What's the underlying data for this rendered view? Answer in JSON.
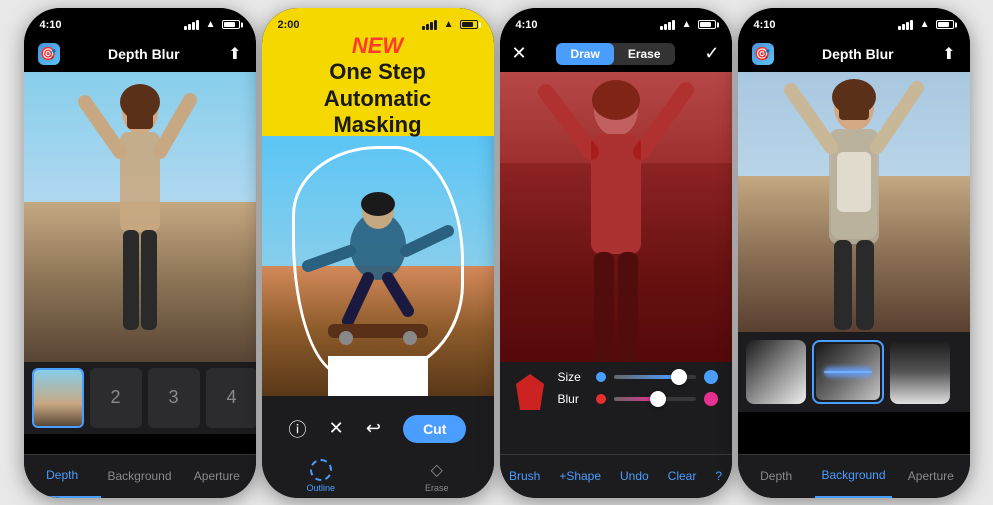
{
  "phones": {
    "phone1": {
      "status": {
        "time": "4:10",
        "signal": true,
        "wifi": true,
        "battery": true
      },
      "nav": {
        "title": "Depth Blur",
        "logo": "🎯"
      },
      "thumbnails": {
        "numbers": [
          "2",
          "3",
          "4"
        ]
      },
      "tabs": [
        "Depth",
        "Background",
        "Aperture"
      ]
    },
    "phone2": {
      "status": {
        "time": "2:00"
      },
      "badge": {
        "new_label": "NEW",
        "title_line1": "One Step",
        "title_line2": "Automatic Masking"
      },
      "toolbar": {
        "cut_label": "Cut"
      },
      "tools": {
        "outline_label": "Outline",
        "erase_label": "Erase"
      }
    },
    "phone3": {
      "status": {
        "time": "4:10"
      },
      "nav": {
        "draw_label": "Draw",
        "erase_label": "Erase"
      },
      "controls": {
        "size_label": "Size",
        "blur_label": "Blur"
      },
      "bottom_actions": {
        "brush": "Brush",
        "shape": "+Shape",
        "undo": "Undo",
        "clear": "Clear",
        "info": "?"
      }
    },
    "phone4": {
      "status": {
        "time": "4:10"
      },
      "nav": {
        "title": "Depth Blur"
      },
      "tabs": [
        "Depth",
        "Background",
        "Aperture"
      ]
    }
  },
  "colors": {
    "accent": "#4a9eff",
    "active_tab": "#4a9eff",
    "badge_bg": "#f5d800",
    "badge_new": "#ff3b30",
    "background_dark": "#1c1c1e",
    "cut_button": "#4a9eff",
    "size_dot": "#4a9eff",
    "blur_dot": "#e63030"
  }
}
